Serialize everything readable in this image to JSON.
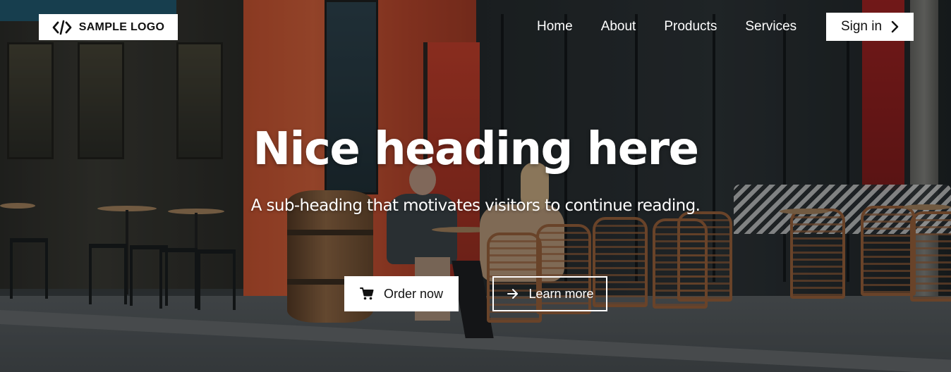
{
  "header": {
    "logo_text": "SAMPLE LOGO",
    "logo_icon": "code-icon",
    "nav": [
      "Home",
      "About",
      "Products",
      "Services"
    ],
    "signin_label": "Sign in",
    "signin_icon": "chevron-right-icon"
  },
  "hero": {
    "title": "Nice heading here",
    "subtitle": "A sub-heading that motivates visitors to continue reading.",
    "primary_button": {
      "label": "Order now",
      "icon": "cart-icon"
    },
    "secondary_button": {
      "label": "Learn more",
      "icon": "arrow-right-icon"
    }
  },
  "colors": {
    "button_bg": "#ffffff",
    "button_text": "#111111",
    "text_on_image": "#ffffff"
  }
}
